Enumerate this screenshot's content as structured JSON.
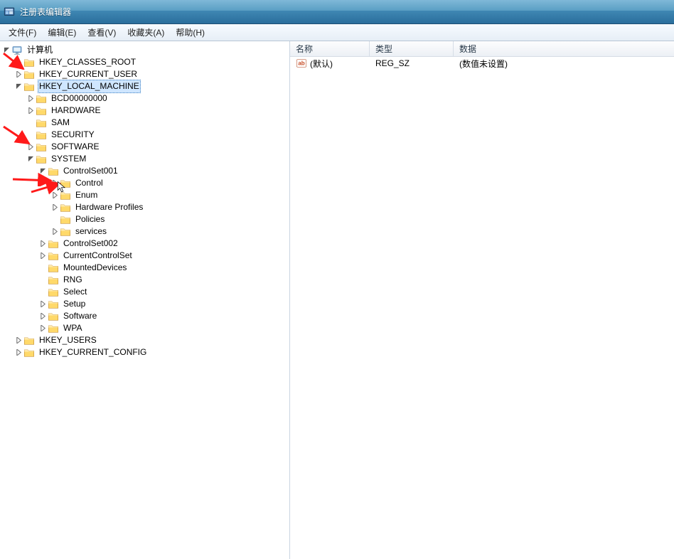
{
  "titlebar": {
    "title": "注册表编辑器"
  },
  "menu": {
    "file": "文件(F)",
    "edit": "编辑(E)",
    "view": "查看(V)",
    "fav": "收藏夹(A)",
    "help": "帮助(H)"
  },
  "tree": {
    "root": {
      "label": "计算机",
      "children": [
        {
          "label": "HKEY_CLASSES_ROOT",
          "expandable": true
        },
        {
          "label": "HKEY_CURRENT_USER",
          "expandable": true
        },
        {
          "label": "HKEY_LOCAL_MACHINE",
          "expandable": true,
          "expanded": true,
          "selected": true,
          "children": [
            {
              "label": "BCD00000000",
              "expandable": true
            },
            {
              "label": "HARDWARE",
              "expandable": true
            },
            {
              "label": "SAM",
              "expandable": false
            },
            {
              "label": "SECURITY",
              "expandable": false
            },
            {
              "label": "SOFTWARE",
              "expandable": true
            },
            {
              "label": "SYSTEM",
              "expandable": true,
              "expanded": true,
              "children": [
                {
                  "label": "ControlSet001",
                  "expandable": true,
                  "expanded": true,
                  "children": [
                    {
                      "label": "Control",
                      "expandable": true
                    },
                    {
                      "label": "Enum",
                      "expandable": true
                    },
                    {
                      "label": "Hardware Profiles",
                      "expandable": true
                    },
                    {
                      "label": "Policies",
                      "expandable": false
                    },
                    {
                      "label": "services",
                      "expandable": true
                    }
                  ]
                },
                {
                  "label": "ControlSet002",
                  "expandable": true
                },
                {
                  "label": "CurrentControlSet",
                  "expandable": true
                },
                {
                  "label": "MountedDevices",
                  "expandable": false
                },
                {
                  "label": "RNG",
                  "expandable": false
                },
                {
                  "label": "Select",
                  "expandable": false
                },
                {
                  "label": "Setup",
                  "expandable": true
                },
                {
                  "label": "Software",
                  "expandable": true
                },
                {
                  "label": "WPA",
                  "expandable": true
                }
              ]
            }
          ]
        },
        {
          "label": "HKEY_USERS",
          "expandable": true
        },
        {
          "label": "HKEY_CURRENT_CONFIG",
          "expandable": true
        }
      ]
    }
  },
  "list": {
    "columns": {
      "name": "名称",
      "type": "类型",
      "data": "数据"
    },
    "rows": [
      {
        "name": "(默认)",
        "type": "REG_SZ",
        "data": "(数值未设置)"
      }
    ]
  }
}
